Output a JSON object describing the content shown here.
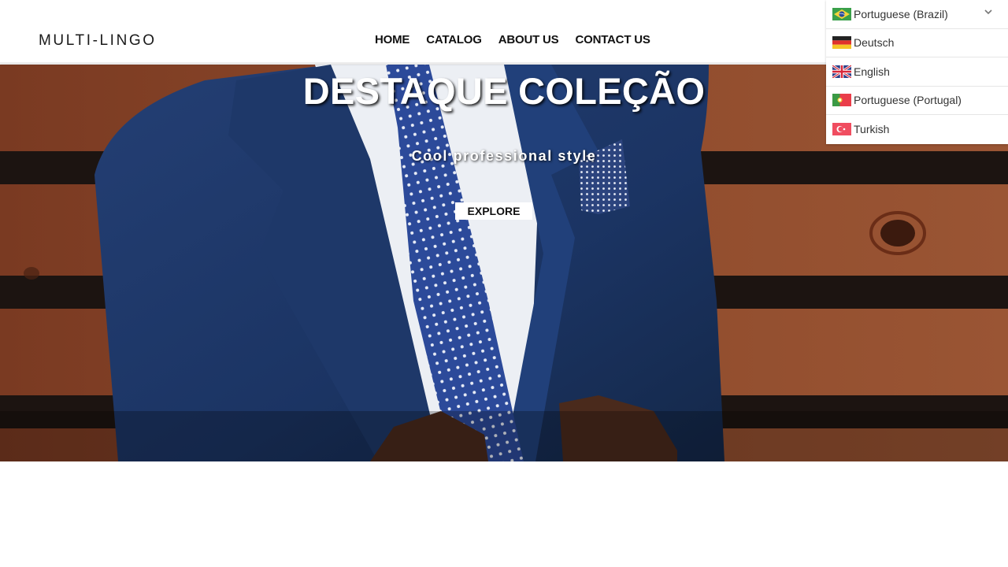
{
  "header": {
    "logo": "MULTI-LINGO",
    "nav": [
      {
        "label": "HOME"
      },
      {
        "label": "CATALOG"
      },
      {
        "label": "ABOUT US"
      },
      {
        "label": "CONTACT US"
      }
    ]
  },
  "hero": {
    "title": "DESTAQUE COLEÇÃO",
    "subtitle": "Cool professional style",
    "button_label": "EXPLORE"
  },
  "language_dropdown": {
    "selected": {
      "label": "Portuguese (Brazil)",
      "flag": "brazil-flag-icon"
    },
    "expand_icon": "chevron-down-icon",
    "options": [
      {
        "label": "Deutsch",
        "flag": "germany-flag-icon"
      },
      {
        "label": "English",
        "flag": "uk-flag-icon"
      },
      {
        "label": "Portuguese (Portugal)",
        "flag": "portugal-flag-icon"
      },
      {
        "label": "Turkish",
        "flag": "turkey-flag-icon"
      }
    ]
  },
  "colors": {
    "header_bg": "#ffffff",
    "hero_wood": "#8a4527",
    "suit_navy": "#1d3563",
    "button_bg": "#ffffff",
    "text_dark": "#111111"
  }
}
